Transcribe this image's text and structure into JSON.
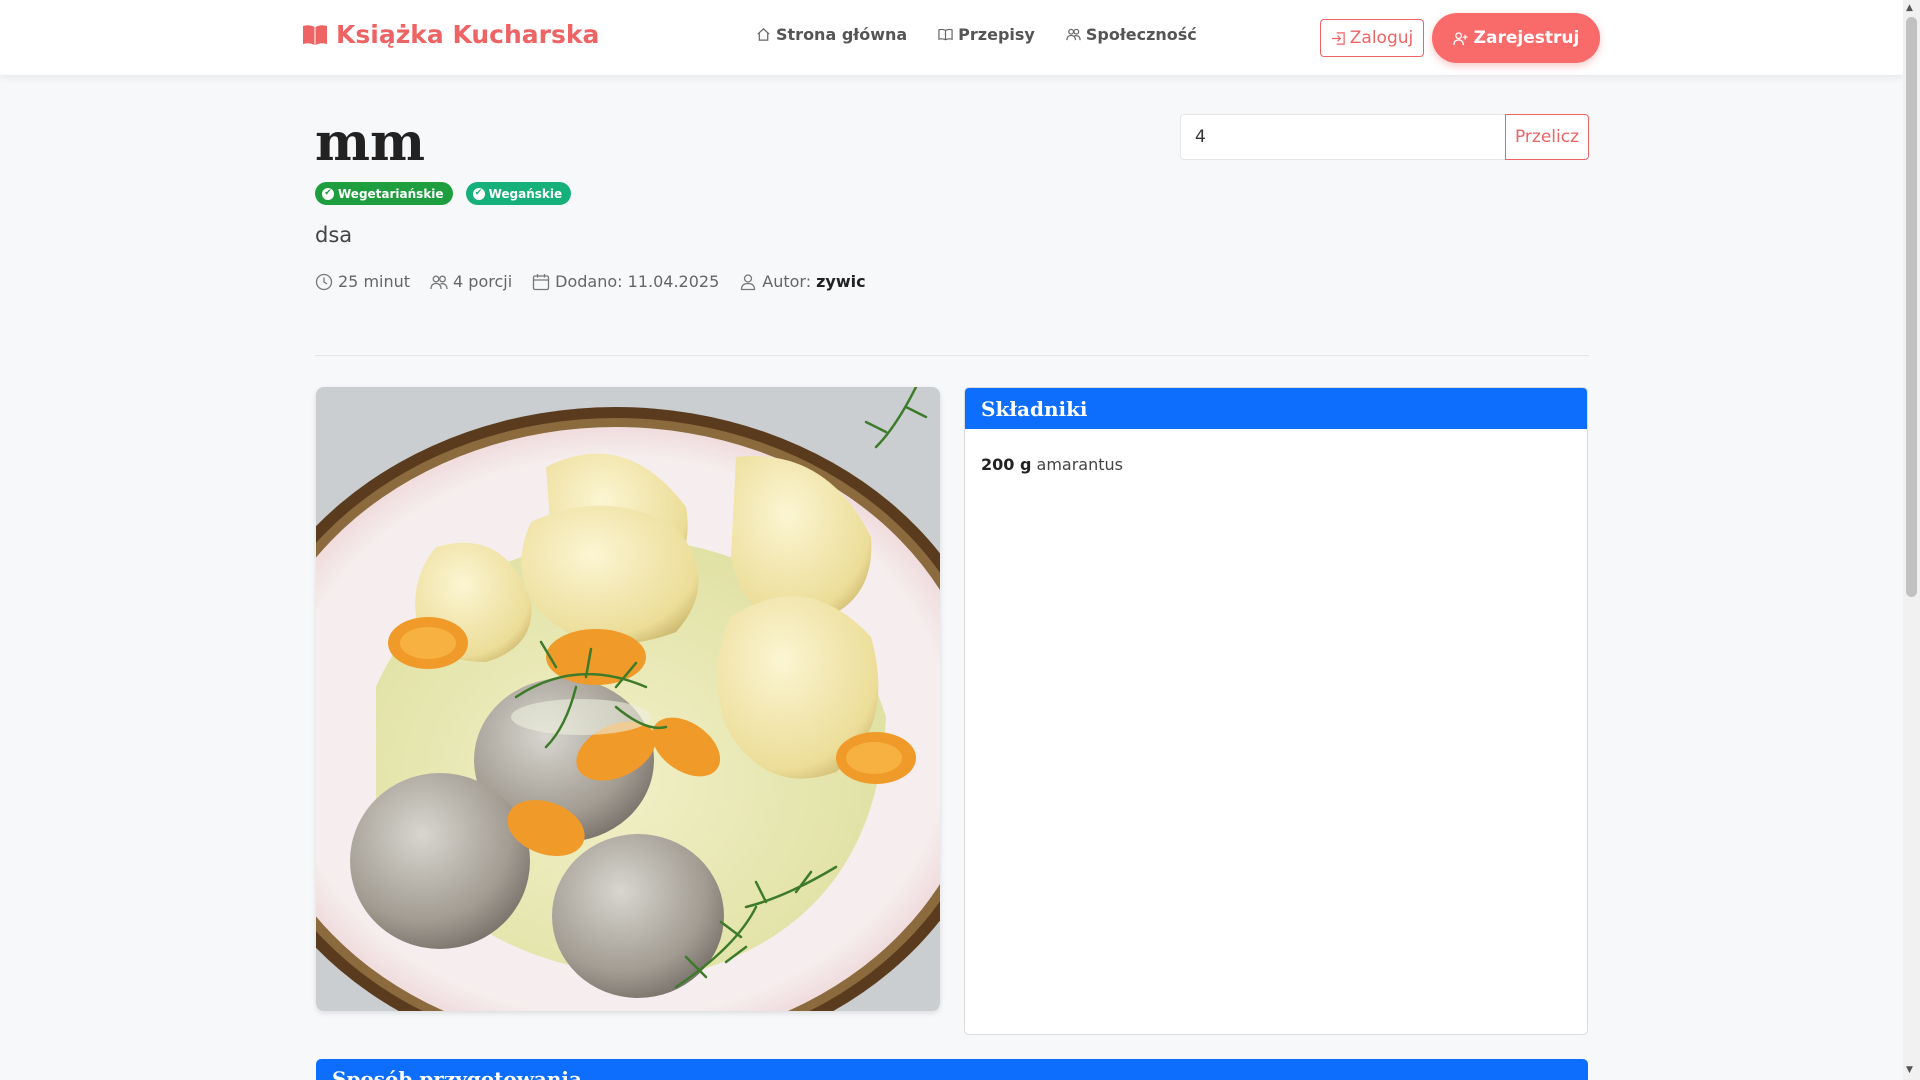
{
  "brand": {
    "name": "Książka Kucharska"
  },
  "nav": {
    "items": [
      {
        "label": "Strona główna",
        "icon": "home-icon"
      },
      {
        "label": "Przepisy",
        "icon": "book-icon"
      },
      {
        "label": "Społeczność",
        "icon": "users-icon"
      }
    ],
    "login_label": "Zaloguj",
    "register_label": "Zarejestruj"
  },
  "recipe": {
    "title": "mm",
    "badges": [
      "Wegetariańskie",
      "Wegańskie"
    ],
    "description": "dsa",
    "meta": {
      "time": "25 minut",
      "servings": "4 porcji",
      "added": "Dodano: 11.04.2025",
      "author_label": "Autor:",
      "author_name": "zywic"
    }
  },
  "servings_form": {
    "value": "4",
    "button_label": "Przelicz"
  },
  "ingredients": {
    "title": "Składniki",
    "items": [
      {
        "amount": "200 g",
        "name": "amarantus"
      }
    ]
  },
  "preparation": {
    "title": "Sposób przygotowania"
  },
  "colors": {
    "accent": "#ee6464",
    "card_header": "#0d6efd",
    "badge_vegetarian": "#1e9e3e",
    "badge_vegan": "#16b07a"
  }
}
